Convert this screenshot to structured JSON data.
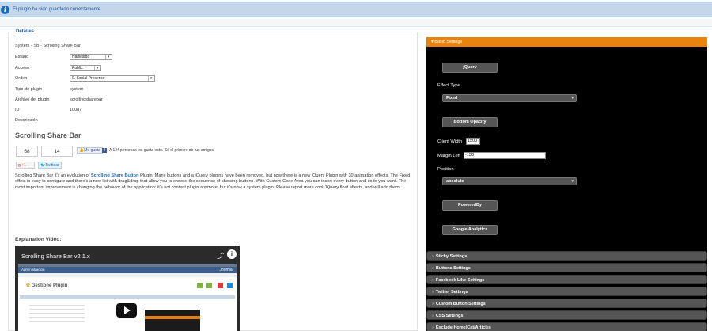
{
  "message": {
    "text": "El plugin ha sido guardado correctamente"
  },
  "details": {
    "legend": "Detalles",
    "subtitle": "System - SB - Scrolling Share Bar",
    "estado_label": "Estado",
    "estado_value": "Habilitado",
    "acceso_label": "Acceso",
    "acceso_value": "Public",
    "orden_label": "Orden",
    "orden_value": "0. Social Presence",
    "tipo_label": "Tipo de plugin",
    "tipo_value": "system",
    "archivo_label": "Archivo del plugin",
    "archivo_value": "scrollingsharebar",
    "id_label": "ID",
    "id_value": "10087",
    "descripcion_label": "Descripción"
  },
  "description": {
    "heading": "Scrolling Share Bar",
    "count_left": "68",
    "count_right": "14",
    "megusta": "Me gusta",
    "fb_icon": "f",
    "fb_text": "A 124 personas les gusta esto. Sé el primero de tus amigos.",
    "gplus": "+1",
    "tweet": "Twittear",
    "para_a": "Scrolling Share Bar it's an evolution of ",
    "para_link": "Scrolling Share Button",
    "para_b": " Plugin. Many buttons and a jQuery plugins have been removed, but now there is a new jQuery Plugin with 30 animation effects. The Fixed effect is easy to configure and there's a new list with drag&drop that allow you to choose the sequence of showing buttons. With Custom Code Area you can insert every button and code you want. The most important improvement is changing the behavior of the application: it's not content plugin anymore, but it's now a system plugin. Please report more cool JQuery float effects, and will add them.",
    "video_heading": "Explanation Video:"
  },
  "video": {
    "title": "Scrolling Share Bar v2.1.x",
    "admin": "Administración",
    "joomla": "Joomla!",
    "plugin_heading": "Gestione Plugin"
  },
  "settings": {
    "open_section": "Basic Settings",
    "jquery_button": "jQuery",
    "effect_type_label": "Effect Type",
    "effect_type_value": "Fixed",
    "bottom_opacity_button": "Bottom Opacity",
    "client_width_label": "Client Width",
    "client_width_value": "1500",
    "margin_left_label": "Margin Left",
    "margin_left_value": "-130",
    "position_label": "Position",
    "position_value": "absolute",
    "poweredby_button": "PoweredBy",
    "ga_button": "Google Analytics",
    "sections": [
      "Sticky Settings",
      "Buttons Settings",
      "Facebook Like Settings",
      "Twitter Settings",
      "Custom Button Settings",
      "CSS Settings",
      "Exclude Home/Cat/Articles"
    ]
  },
  "colors": {
    "accent": "#e8830f",
    "panel_bg": "#000000",
    "section_bg": "#555555",
    "message_bg": "#c3d6ea",
    "link": "#1e6bb8"
  }
}
